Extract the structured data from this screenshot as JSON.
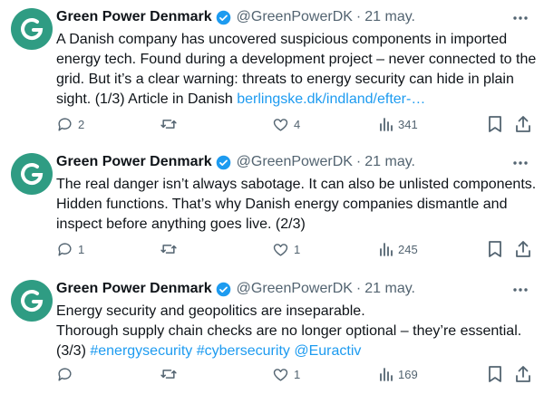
{
  "tweets": [
    {
      "author": {
        "name": "Green Power Denmark",
        "handle": "@GreenPowerDK",
        "date": "21 may."
      },
      "lines": [
        {
          "text": "A Danish company has uncovered suspicious components in imported"
        },
        {
          "text": "energy tech. Found during a development project – never connected to the"
        },
        {
          "text": "grid. But it’s a clear warning: threats to energy security can hide in plain"
        },
        {
          "text": "sight. (1/3) Article in Danish ",
          "link": "berlingske.dk/indland/efter-…"
        }
      ],
      "stats": {
        "replies": "2",
        "retweets": "",
        "likes": "4",
        "views": "341"
      }
    },
    {
      "author": {
        "name": "Green Power Denmark",
        "handle": "@GreenPowerDK",
        "date": "21 may."
      },
      "lines": [
        {
          "text": "The real danger isn’t always sabotage. It can also be unlisted components."
        },
        {
          "text": "Hidden functions. That’s why Danish energy companies dismantle and"
        },
        {
          "text": "inspect before anything goes live. (2/3)"
        }
      ],
      "stats": {
        "replies": "1",
        "retweets": "",
        "likes": "1",
        "views": "245"
      }
    },
    {
      "author": {
        "name": "Green Power Denmark",
        "handle": "@GreenPowerDK",
        "date": "21 may."
      },
      "lines": [
        {
          "text": "Energy security and geopolitics are inseparable."
        },
        {
          "text": "Thorough supply chain checks are no longer optional – they’re essential."
        },
        {
          "text": "(3/3) ",
          "link": "#energysecurity #cybersecurity @Euractiv"
        }
      ],
      "stats": {
        "replies": "",
        "retweets": "",
        "likes": "1",
        "views": "169"
      }
    }
  ],
  "colors": {
    "accent": "#1d9bf0",
    "muted": "#536471",
    "avatar": "#2f9c83"
  }
}
